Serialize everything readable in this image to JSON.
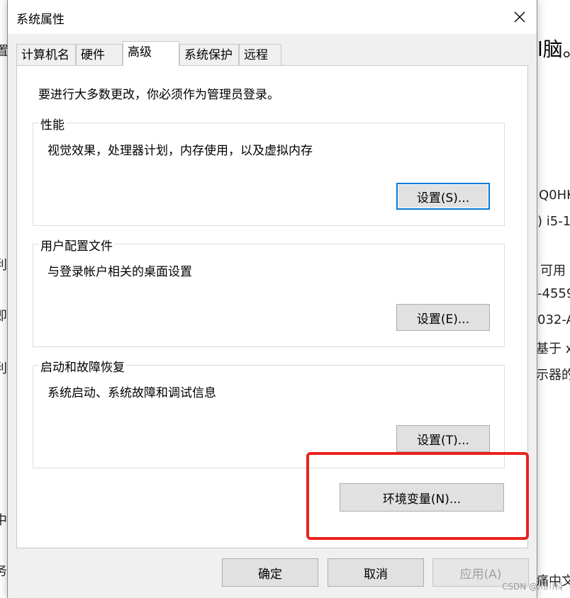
{
  "background": {
    "heading_fragment": "l脑。",
    "right_lines": [
      "Q0HK",
      ") i5-1",
      "可用",
      "-4559",
      "032-A",
      "基于 x",
      "示器的"
    ],
    "left_chars": [
      "置",
      "利",
      "即",
      "利",
      "中",
      "务"
    ],
    "bottom_right_fragment": "痛中文"
  },
  "dialog": {
    "title": "系统属性",
    "tabs": [
      "计算机名",
      "硬件",
      "高级",
      "系统保护",
      "远程"
    ],
    "active_tab": "高级",
    "notice": "要进行大多数更改，你必须作为管理员登录。",
    "groups": [
      {
        "legend": "性能",
        "description": "视觉效果，处理器计划，内存使用，以及虚拟内存",
        "button": "设置(S)..."
      },
      {
        "legend": "用户配置文件",
        "description": "与登录帐户相关的桌面设置",
        "button": "设置(E)..."
      },
      {
        "legend": "启动和故障恢复",
        "description": "系统启动、系统故障和调试信息",
        "button": "设置(T)..."
      }
    ],
    "env_button": "环境变量(N)...",
    "footer": {
      "ok": "确定",
      "cancel": "取消",
      "apply": "应用(A)"
    }
  },
  "watermark": "CSDN @川川科",
  "colors": {
    "accent": "#0078d7",
    "annotation": "#e8231c"
  }
}
